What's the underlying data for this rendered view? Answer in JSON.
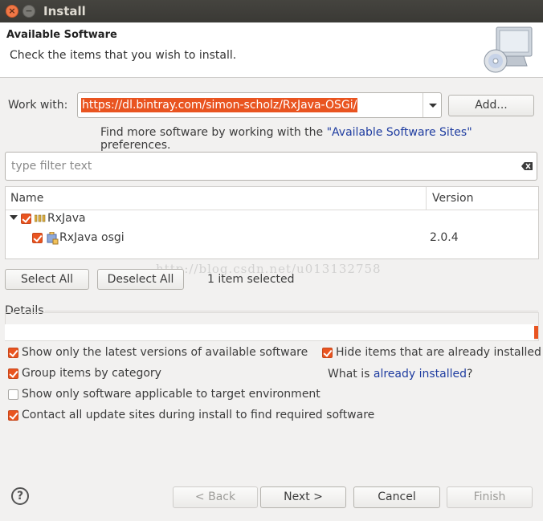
{
  "window": {
    "title": "Install"
  },
  "header": {
    "title": "Available Software",
    "subtitle": "Check the items that you wish to install."
  },
  "work_with": {
    "label": "Work with:",
    "url": "https://dl.bintray.com/simon-scholz/RxJava-OSGi/",
    "add_label": "Add...",
    "find_more_prefix": "Find more software by working with the ",
    "find_more_link": "\"Available Software Sites\"",
    "find_more_suffix": " preferences."
  },
  "filter": {
    "placeholder": "type filter text"
  },
  "tree": {
    "columns": [
      "Name",
      "Version"
    ],
    "rows": [
      {
        "name": "RxJava",
        "version": "",
        "checked": true,
        "expanded": true,
        "type": "category"
      },
      {
        "name": "RxJava osgi",
        "version": "2.0.4",
        "checked": true,
        "type": "feature"
      }
    ]
  },
  "selection": {
    "select_all_label": "Select All",
    "deselect_all_label": "Deselect All",
    "count_text": "1 item selected"
  },
  "watermark": "http://blog.csdn.net/u013132758",
  "details": {
    "label": "Details"
  },
  "options": {
    "latest_versions": {
      "label": "Show only the latest versions of available software",
      "checked": true
    },
    "hide_installed": {
      "label": "Hide items that are already installed",
      "checked": true
    },
    "group_by_category": {
      "label": "Group items by category",
      "checked": true
    },
    "what_is_prefix": "What is ",
    "what_is_link": "already installed",
    "what_is_suffix": "?",
    "target_env": {
      "label": "Show only software applicable to target environment",
      "checked": false
    },
    "contact_sites": {
      "label": "Contact all update sites during install to find required software",
      "checked": true
    }
  },
  "footer": {
    "help_glyph": "?",
    "back_label": "< Back",
    "next_label": "Next >",
    "cancel_label": "Cancel",
    "finish_label": "Finish"
  },
  "colors": {
    "accent": "#e95420",
    "link": "#1e3ca0",
    "titlebar": "#3f3e3a"
  }
}
